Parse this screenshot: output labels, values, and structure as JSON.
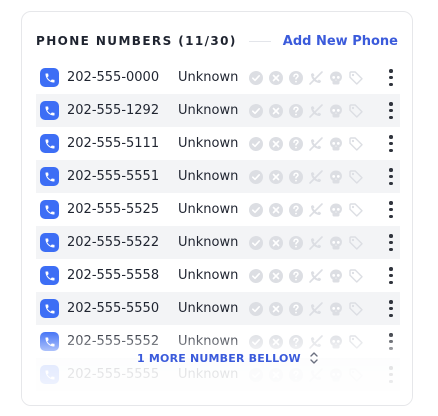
{
  "header": {
    "title": "PHONE NUMBERS (11/30)",
    "add_label": "Add New Phone"
  },
  "rows": [
    {
      "number": "202-555-0000",
      "status": "Unknown"
    },
    {
      "number": "202-555-1292",
      "status": "Unknown"
    },
    {
      "number": "202-555-5111",
      "status": "Unknown"
    },
    {
      "number": "202-555-5551",
      "status": "Unknown"
    },
    {
      "number": "202-555-5525",
      "status": "Unknown"
    },
    {
      "number": "202-555-5522",
      "status": "Unknown"
    },
    {
      "number": "202-555-5558",
      "status": "Unknown"
    },
    {
      "number": "202-555-5550",
      "status": "Unknown"
    },
    {
      "number": "202-555-5552",
      "status": "Unknown"
    },
    {
      "number": "202-555-5555",
      "status": "Unknown"
    }
  ],
  "footer": {
    "more_label": "1 MORE NUMBER BELLOW"
  },
  "icons": [
    "phone-icon",
    "check-circle-icon",
    "x-circle-icon",
    "question-circle-icon",
    "no-call-icon",
    "skull-icon",
    "tag-icon",
    "more-vertical-icon",
    "chevron-up-down-icon"
  ],
  "colors": {
    "accent": "#3b5bdb",
    "phone_badge": "#3d6ef5",
    "row_alt": "#f3f4f6",
    "icon_muted": "#dcdee3"
  }
}
